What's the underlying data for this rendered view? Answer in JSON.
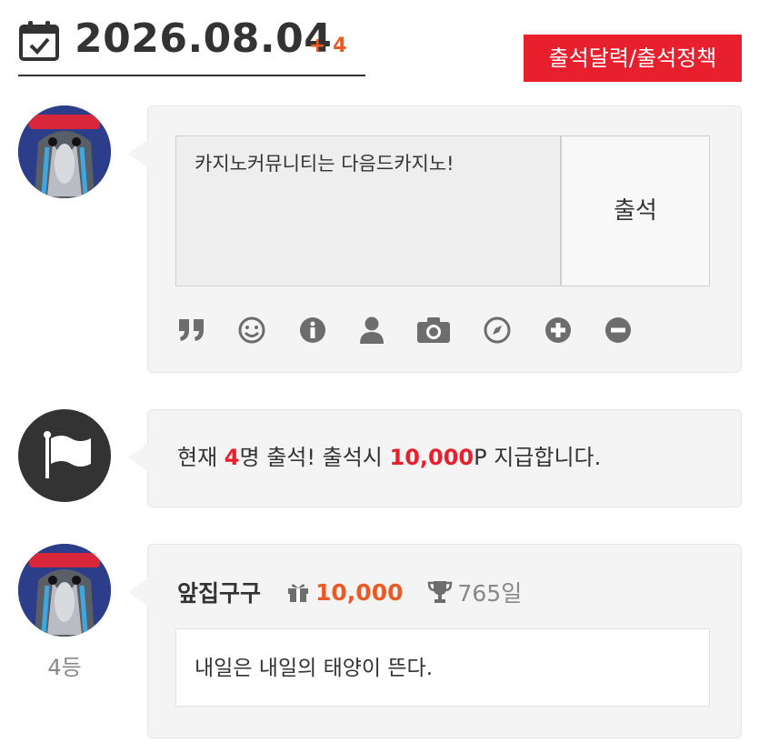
{
  "header": {
    "date": "2026.08.04",
    "date_delta": "+ 4",
    "policy_button": "출석달력/출석정책"
  },
  "checkin": {
    "textarea_value": "카지노커뮤니티는 다음드카지노!",
    "submit_label": "출석",
    "toolbar_icons": [
      "quote-icon",
      "smiley-icon",
      "info-icon",
      "user-icon",
      "camera-icon",
      "compass-icon",
      "plus-circle-icon",
      "minus-circle-icon"
    ]
  },
  "status": {
    "prefix": "현재 ",
    "count": "4",
    "middle": "명 출석! 출석시 ",
    "points": "10,000",
    "suffix": "P 지급합니다."
  },
  "entry": {
    "username": "앞집구구",
    "points": "10,000",
    "days": "765일",
    "rank": "4등",
    "comment": "내일은 내일의 태양이 뜬다."
  },
  "colors": {
    "accent_red": "#e8202d",
    "points_orange": "#ea5a24",
    "icon_gray": "#6d6d6d"
  }
}
